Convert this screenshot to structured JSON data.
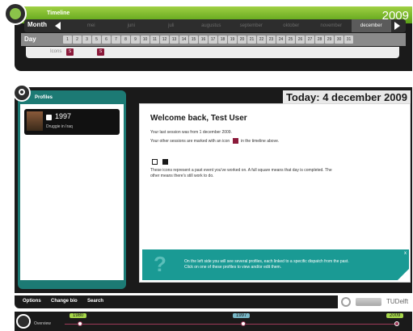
{
  "timeline": {
    "title": "Timeline",
    "year": "2009",
    "month_label": "Month",
    "day_label": "Day",
    "icons_label": "Icons",
    "months": [
      "mei",
      "juni",
      "juli",
      "augustus",
      "september",
      "oktober",
      "november",
      "december"
    ],
    "active_month": "december",
    "days": [
      "1",
      "2",
      "3",
      "4",
      "5",
      "6",
      "7",
      "8",
      "9",
      "10",
      "11",
      "12",
      "13",
      "14",
      "15",
      "16",
      "17",
      "18",
      "19",
      "20",
      "21",
      "22",
      "23",
      "24",
      "25",
      "26",
      "27",
      "28",
      "29",
      "30",
      "31"
    ],
    "today_day": "4",
    "session_icon_text": "S"
  },
  "profiles": {
    "title": "Profiles",
    "items": [
      {
        "year": "1997",
        "subtitle": "Druggie in Iraq"
      }
    ]
  },
  "today_header": "Today: 4 december 2009",
  "welcome": {
    "title": "Welcome back, Test User",
    "last_session": "Your last session was from 1 december 2009.",
    "other_sessions_a": "Your other sessions are marked with an icon",
    "other_sessions_b": "in the timeline above.",
    "icons_explain_1": "These icons represent a past event you've worked on. A full square means that day is completed. The",
    "icons_explain_2": "other means there's still work to do.",
    "note_1": "On the left side you will see several profiles, each linked to a specific dispatch from the past.",
    "note_2": "Click on one of these profiles to view and/or edit them.",
    "note_close": "x"
  },
  "toolbar": {
    "options": "Options",
    "change_bio": "Change bio",
    "search": "Search",
    "logo_right": "TUDelft"
  },
  "overview": {
    "label": "Overview",
    "tags": [
      "1980",
      "1997",
      "2009"
    ]
  },
  "colors": {
    "green": "#8bc34a",
    "teal": "#1c7a74",
    "session_red": "#8b1a3a",
    "dark": "#1a1a1a"
  }
}
